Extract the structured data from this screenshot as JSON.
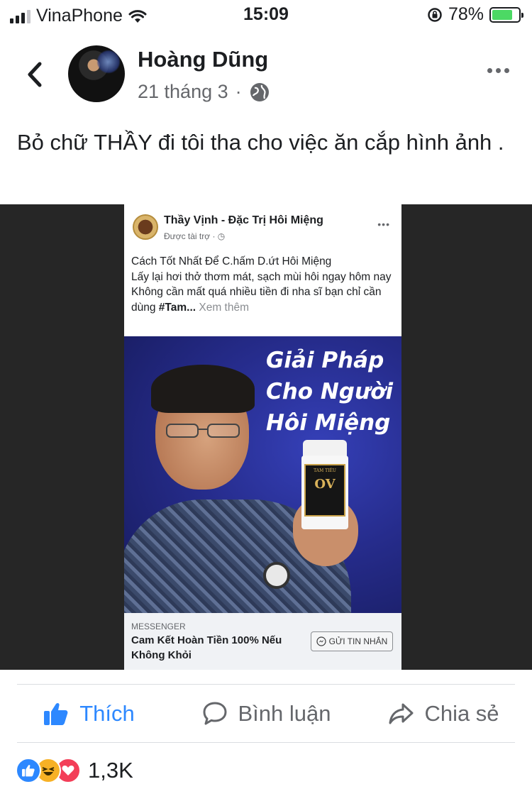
{
  "status_bar": {
    "carrier": "VinaPhone",
    "time": "15:09",
    "battery": "78%"
  },
  "post": {
    "author": "Hoàng Dũng",
    "date": "21 tháng 3",
    "text": "Bỏ chữ THẦY đi tôi tha cho việc ăn cắp hình ảnh ."
  },
  "ad": {
    "page_name": "Thầy Vịnh - Đặc Trị Hôi Miệng",
    "sponsored": "Được tài trợ",
    "text_line1": "Cách Tốt Nhất Để C.hấm D.ứt Hôi Miệng",
    "text_line2": "Lấy lại hơi thở thơm mát, sạch mùi hôi ngay hôm nay",
    "text_line3_prefix": "Không cần mất quá nhiều tiền đi nha sĩ bạn chỉ cần dùng ",
    "text_line3_bold": "#Tam...",
    "see_more": "Xem thêm",
    "headline": [
      "Giải Pháp",
      "Cho Người",
      "Hôi Miệng"
    ],
    "bottle_brand": "TAM TIÊU",
    "bottle_code": "OV",
    "footer_kicker": "MESSENGER",
    "footer_title": "Cam Kết Hoàn Tiền 100% Nếu Không Khỏi",
    "footer_button": "GỬI TIN NHẮN"
  },
  "actions": {
    "like": "Thích",
    "comment": "Bình luận",
    "share": "Chia sẻ"
  },
  "reactions": {
    "count": "1,3K"
  },
  "colors": {
    "like_blue": "#2d88ff",
    "secondary_text": "#65676b",
    "ad_background": "#262c8c"
  },
  "icons": [
    "back-chevron-icon",
    "globe-icon",
    "more-options-icon",
    "thumbs-up-icon",
    "comment-icon",
    "share-icon",
    "messenger-icon"
  ]
}
